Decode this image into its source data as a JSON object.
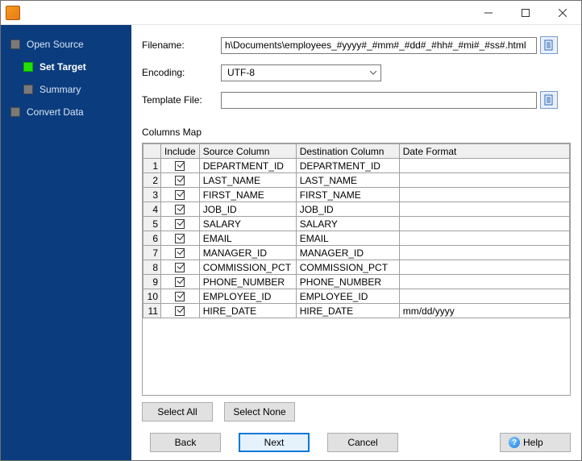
{
  "sidebar": {
    "items": [
      {
        "label": "Open Source",
        "indent": 0,
        "active": false
      },
      {
        "label": "Set Target",
        "indent": 1,
        "active": true
      },
      {
        "label": "Summary",
        "indent": 1,
        "active": false
      },
      {
        "label": "Convert Data",
        "indent": 0,
        "active": false
      }
    ]
  },
  "form": {
    "filename_label": "Filename:",
    "filename_value": "h\\Documents\\employees_#yyyy#_#mm#_#dd#_#hh#_#mi#_#ss#.html",
    "encoding_label": "Encoding:",
    "encoding_value": "UTF-8",
    "template_label": "Template File:",
    "template_value": ""
  },
  "columns_map_title": "Columns Map",
  "table": {
    "headers": {
      "include": "Include",
      "source": "Source Column",
      "destination": "Destination Column",
      "format": "Date Format"
    },
    "rows": [
      {
        "n": "1",
        "include": true,
        "source": "DEPARTMENT_ID",
        "destination": "DEPARTMENT_ID",
        "format": ""
      },
      {
        "n": "2",
        "include": true,
        "source": "LAST_NAME",
        "destination": "LAST_NAME",
        "format": ""
      },
      {
        "n": "3",
        "include": true,
        "source": "FIRST_NAME",
        "destination": "FIRST_NAME",
        "format": ""
      },
      {
        "n": "4",
        "include": true,
        "source": "JOB_ID",
        "destination": "JOB_ID",
        "format": ""
      },
      {
        "n": "5",
        "include": true,
        "source": "SALARY",
        "destination": "SALARY",
        "format": ""
      },
      {
        "n": "6",
        "include": true,
        "source": "EMAIL",
        "destination": "EMAIL",
        "format": ""
      },
      {
        "n": "7",
        "include": true,
        "source": "MANAGER_ID",
        "destination": "MANAGER_ID",
        "format": ""
      },
      {
        "n": "8",
        "include": true,
        "source": "COMMISSION_PCT",
        "destination": "COMMISSION_PCT",
        "format": ""
      },
      {
        "n": "9",
        "include": true,
        "source": "PHONE_NUMBER",
        "destination": "PHONE_NUMBER",
        "format": ""
      },
      {
        "n": "10",
        "include": true,
        "source": "EMPLOYEE_ID",
        "destination": "EMPLOYEE_ID",
        "format": ""
      },
      {
        "n": "11",
        "include": true,
        "source": "HIRE_DATE",
        "destination": "HIRE_DATE",
        "format": "mm/dd/yyyy"
      }
    ]
  },
  "buttons": {
    "select_all": "Select All",
    "select_none": "Select None",
    "back": "Back",
    "next": "Next",
    "cancel": "Cancel",
    "help": "Help"
  }
}
